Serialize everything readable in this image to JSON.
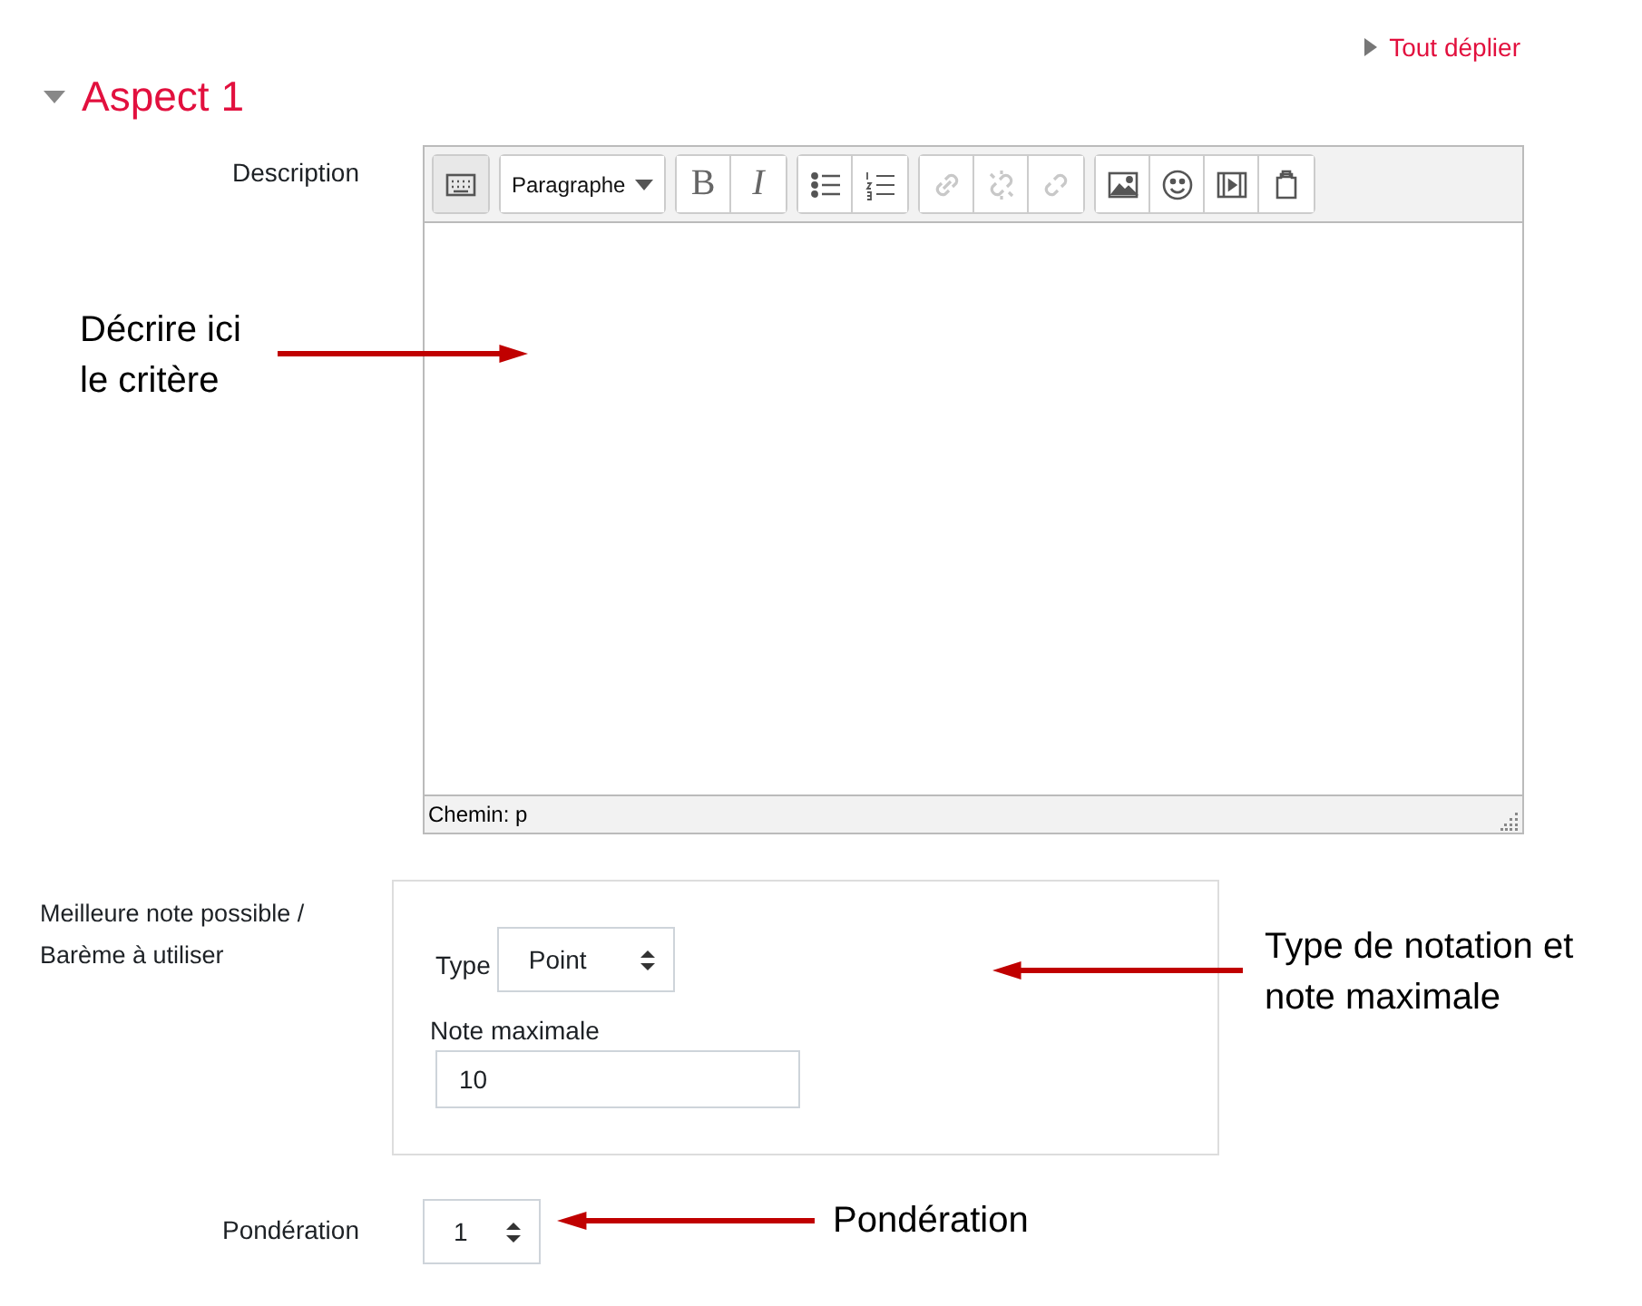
{
  "expand_all": {
    "label": "Tout déplier"
  },
  "section": {
    "title": "Aspect 1",
    "expanded": true
  },
  "description": {
    "label": "Description",
    "toolbar": [
      {
        "buttons": [
          {
            "kind": "toggle",
            "disabled": false
          }
        ]
      },
      {
        "buttons": [
          {
            "kind": "format",
            "value": "Paragraphe",
            "disabled": false
          }
        ]
      },
      {
        "buttons": [
          {
            "kind": "bold",
            "label": "B",
            "disabled": false
          },
          {
            "kind": "italic",
            "label": "I",
            "disabled": false
          }
        ]
      },
      {
        "buttons": [
          {
            "kind": "bullets",
            "disabled": false
          },
          {
            "kind": "numbers",
            "disabled": false
          }
        ]
      },
      {
        "buttons": [
          {
            "kind": "link",
            "disabled": true
          },
          {
            "kind": "unlink",
            "disabled": true
          },
          {
            "kind": "anchor",
            "disabled": true
          }
        ]
      },
      {
        "buttons": [
          {
            "kind": "image",
            "disabled": false
          },
          {
            "kind": "emoji",
            "disabled": false
          },
          {
            "kind": "media",
            "disabled": false
          },
          {
            "kind": "paste",
            "disabled": false
          }
        ]
      }
    ],
    "path": "Chemin: p"
  },
  "grade": {
    "label": "Meilleure note possible / Barème à utiliser",
    "type_label": "Type",
    "type_value": "Point",
    "max_label": "Note maximale",
    "max_value": "10"
  },
  "weight": {
    "label": "Pondération",
    "value": "1"
  },
  "annotations": [
    {
      "text": "Décrire ici le critère"
    },
    {
      "text": "Type de notation et note maximale"
    },
    {
      "text": "Pondération"
    }
  ]
}
